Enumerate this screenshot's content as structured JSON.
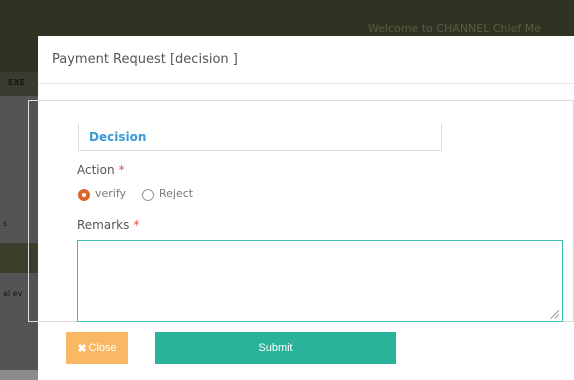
{
  "background": {
    "header_text": "Welcome to CHANNEL Chief Me",
    "sidebar_label": "EXE",
    "fragment_1": "s",
    "fragment_2": "al ev"
  },
  "modal": {
    "title": "Payment Request [decision ]",
    "legend": "Decision",
    "action_label": "Action",
    "required_mark": "*",
    "options": [
      {
        "label": "verify",
        "checked": true
      },
      {
        "label": "Reject",
        "checked": false
      }
    ],
    "remarks_label": "Remarks",
    "remarks_value": "",
    "close_label": "Close",
    "submit_label": "Submit"
  },
  "colors": {
    "accent_teal": "#2ab39b",
    "close_orange": "#f9b864",
    "legend_blue": "#3a9bd6",
    "required_red": "#e84c3d",
    "radio_orange": "#e0642e"
  }
}
